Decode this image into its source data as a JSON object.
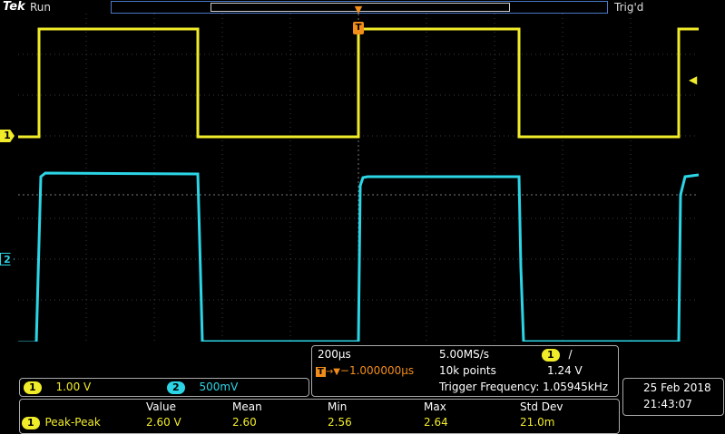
{
  "header": {
    "brand": "Tek",
    "run_state": "Run",
    "trigger_status": "Trig'd"
  },
  "channels": [
    {
      "id": "1",
      "color": "#f1ec2a",
      "scale": "1.00 V"
    },
    {
      "id": "2",
      "color": "#2bd5e6",
      "scale": "500mV"
    }
  ],
  "horizontal": {
    "time_div": "200µs",
    "sample_rate": "5.00MS/s",
    "trigger_source": "1",
    "trigger_slope": "/",
    "delay": "−1.000000µs",
    "record_length": "10k points",
    "trigger_level": "1.24 V",
    "trigger_frequency": "Trigger Frequency: 1.05945kHz"
  },
  "datetime": {
    "date": "25 Feb  2018",
    "time": "21:43:07"
  },
  "measurements": {
    "headers": [
      "Value",
      "Mean",
      "Min",
      "Max",
      "Std Dev"
    ],
    "rows": [
      {
        "channel": "1",
        "type": "Peak-Peak",
        "values": [
          "2.60 V",
          "2.60",
          "2.56",
          "2.64",
          "21.0m"
        ]
      }
    ]
  },
  "markers": {
    "trigger_marker": "T",
    "ch1_marker": "1",
    "ch2_marker": "2"
  }
}
